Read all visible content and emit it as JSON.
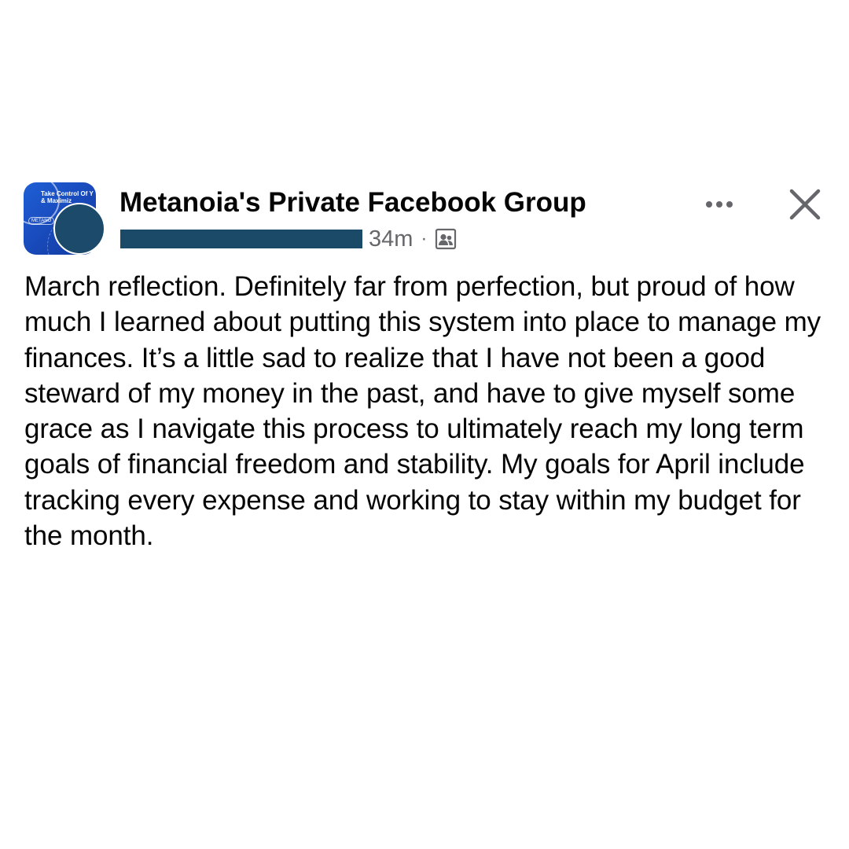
{
  "header": {
    "group_name": "Metanoia's Private Facebook Group",
    "timestamp": "34m",
    "separator": "·",
    "audience_icon": "group-members-icon",
    "more_icon": "more-options-icon",
    "close_icon": "close-icon"
  },
  "group_avatar": {
    "text_line1": "Take Control Of Y",
    "text_line2": "& Maximiz",
    "logo_text": "METANO"
  },
  "post": {
    "text": "March reflection. Definitely far from perfection, but proud of how much I learned about putting this system into place to manage my finances. It’s a little sad to realize that I have not been a good steward of my money in the past, and have to give myself some grace as I navigate this process to ultimately reach my long term goals of financial freedom and stability. My goals for April include tracking every expense and working to stay within my budget for the month."
  },
  "colors": {
    "text_primary": "#050505",
    "text_secondary": "#65676b",
    "redaction": "#1a4a68",
    "avatar_blue": "#1f5fd6",
    "background": "#ffffff"
  }
}
